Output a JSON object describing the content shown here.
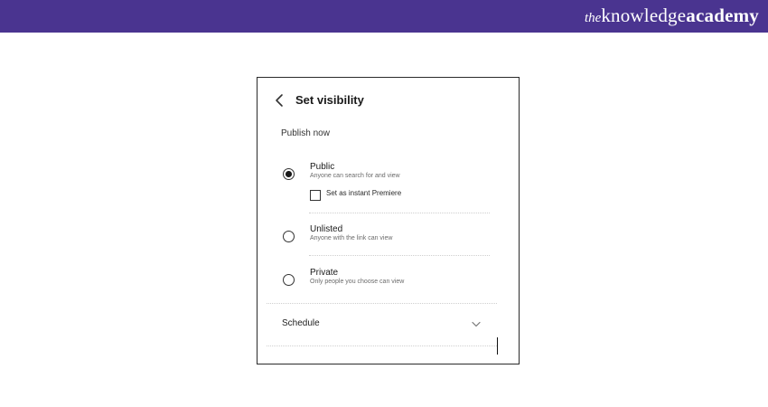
{
  "brand": {
    "the": "the",
    "knowledge": "knowledge",
    "academy": "academy",
    "bar_color": "#4a3490"
  },
  "screen": {
    "title": "Set visibility",
    "back_icon": "chevron-left-icon",
    "section_label": "Publish now",
    "options": [
      {
        "title": "Public",
        "description": "Anyone can search for and view",
        "selected": true
      },
      {
        "title": "Unlisted",
        "description": "Anyone with the link can view",
        "selected": false
      },
      {
        "title": "Private",
        "description": "Only people you choose can view",
        "selected": false
      }
    ],
    "premiere_checkbox": {
      "label": "Set as instant Premiere",
      "checked": false
    },
    "schedule": {
      "label": "Schedule",
      "icon": "chevron-down-icon"
    }
  }
}
